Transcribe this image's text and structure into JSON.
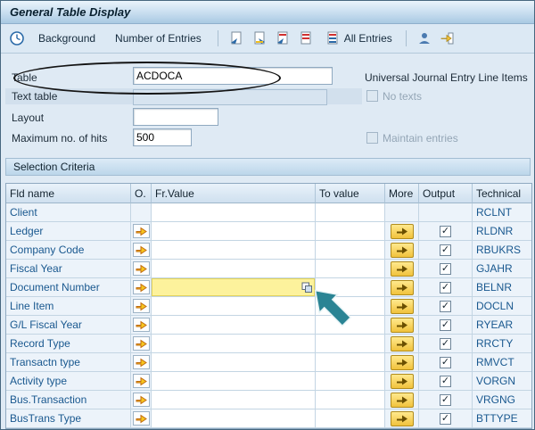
{
  "window": {
    "title": "General Table Display"
  },
  "toolbar": {
    "background": "Background",
    "number_of_entries": "Number of Entries",
    "all_entries": "All Entries"
  },
  "form": {
    "table": {
      "label": "Table",
      "value": "ACDOCA",
      "description": "Universal Journal Entry Line Items"
    },
    "text_table": {
      "label": "Text table",
      "value": ""
    },
    "no_texts": {
      "label": "No texts",
      "checked": false
    },
    "layout": {
      "label": "Layout",
      "value": ""
    },
    "max_hits": {
      "label": "Maximum no. of hits",
      "value": "500"
    },
    "maintain_entries": {
      "label": "Maintain entries",
      "checked": false
    }
  },
  "selection": {
    "title": "Selection Criteria",
    "columns": {
      "fld": "Fld name",
      "o": "O.",
      "from": "Fr.Value",
      "to": "To value",
      "more": "More",
      "output": "Output",
      "technical": "Technical"
    },
    "rows": [
      {
        "name": "Client",
        "technical": "RCLNT",
        "o_button": false,
        "more_button": false,
        "output_checked": false,
        "from_highlighted": false
      },
      {
        "name": "Ledger",
        "technical": "RLDNR",
        "o_button": true,
        "more_button": true,
        "output_checked": true,
        "from_highlighted": false
      },
      {
        "name": "Company Code",
        "technical": "RBUKRS",
        "o_button": true,
        "more_button": true,
        "output_checked": true,
        "from_highlighted": false
      },
      {
        "name": "Fiscal Year",
        "technical": "GJAHR",
        "o_button": true,
        "more_button": true,
        "output_checked": true,
        "from_highlighted": false
      },
      {
        "name": "Document Number",
        "technical": "BELNR",
        "o_button": true,
        "more_button": true,
        "output_checked": true,
        "from_highlighted": true
      },
      {
        "name": "Line Item",
        "technical": "DOCLN",
        "o_button": true,
        "more_button": true,
        "output_checked": true,
        "from_highlighted": false
      },
      {
        "name": "G/L Fiscal Year",
        "technical": "RYEAR",
        "o_button": true,
        "more_button": true,
        "output_checked": true,
        "from_highlighted": false
      },
      {
        "name": "Record Type",
        "technical": "RRCTY",
        "o_button": true,
        "more_button": true,
        "output_checked": true,
        "from_highlighted": false
      },
      {
        "name": "Transactn type",
        "technical": "RMVCT",
        "o_button": true,
        "more_button": true,
        "output_checked": true,
        "from_highlighted": false
      },
      {
        "name": "Activity type",
        "technical": "VORGN",
        "o_button": true,
        "more_button": true,
        "output_checked": true,
        "from_highlighted": false
      },
      {
        "name": "Bus.Transaction",
        "technical": "VRGNG",
        "o_button": true,
        "more_button": true,
        "output_checked": true,
        "from_highlighted": false
      },
      {
        "name": "BusTrans Type",
        "technical": "BTTYPE",
        "o_button": true,
        "more_button": true,
        "output_checked": true,
        "from_highlighted": false
      }
    ]
  },
  "colors": {
    "highlight_yellow": "#fdf29c",
    "link_blue": "#19588f",
    "annotation_teal": "#2a8494",
    "button_yellow": "#f1c23c"
  }
}
